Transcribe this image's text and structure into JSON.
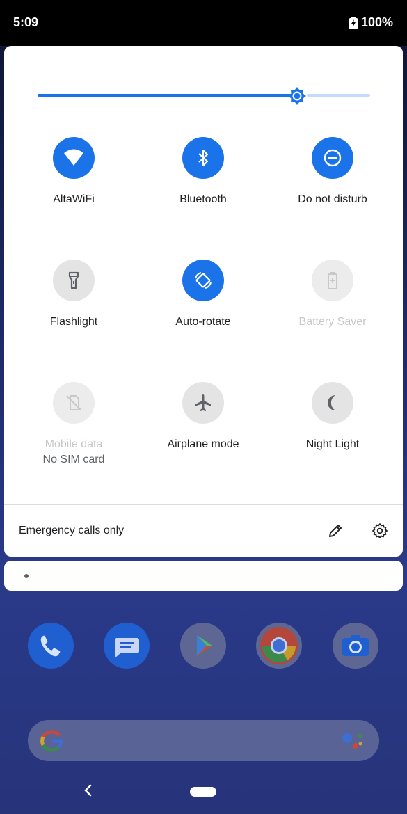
{
  "status_bar": {
    "time": "5:09",
    "battery": "100%"
  },
  "brightness": {
    "level": 0.78
  },
  "quick_settings": {
    "tiles": [
      {
        "label": "AltaWiFi",
        "state": "on",
        "icon": "wifi-icon"
      },
      {
        "label": "Bluetooth",
        "state": "on",
        "icon": "bluetooth-icon"
      },
      {
        "label": "Do not disturb",
        "state": "on",
        "icon": "do-not-disturb-icon"
      },
      {
        "label": "Flashlight",
        "state": "off",
        "icon": "flashlight-icon"
      },
      {
        "label": "Auto-rotate",
        "state": "on",
        "icon": "auto-rotate-icon"
      },
      {
        "label": "Battery Saver",
        "state": "disabled",
        "icon": "battery-saver-icon"
      },
      {
        "label": "Mobile data",
        "sublabel": "No SIM card",
        "state": "disabled",
        "icon": "mobile-data-off-icon"
      },
      {
        "label": "Airplane mode",
        "state": "off",
        "icon": "airplane-icon"
      },
      {
        "label": "Night Light",
        "state": "off",
        "icon": "night-light-icon"
      }
    ],
    "footer": {
      "carrier_text": "Emergency calls only",
      "edit_icon": "pencil-icon",
      "settings_icon": "gear-icon"
    }
  },
  "colors": {
    "accent": "#1a73e8",
    "tile_off": "#e4e4e4",
    "panel": "#ffffff"
  },
  "home": {
    "dock_apps": [
      "phone-icon",
      "messages-icon",
      "play-store-icon",
      "chrome-icon",
      "camera-icon"
    ]
  }
}
